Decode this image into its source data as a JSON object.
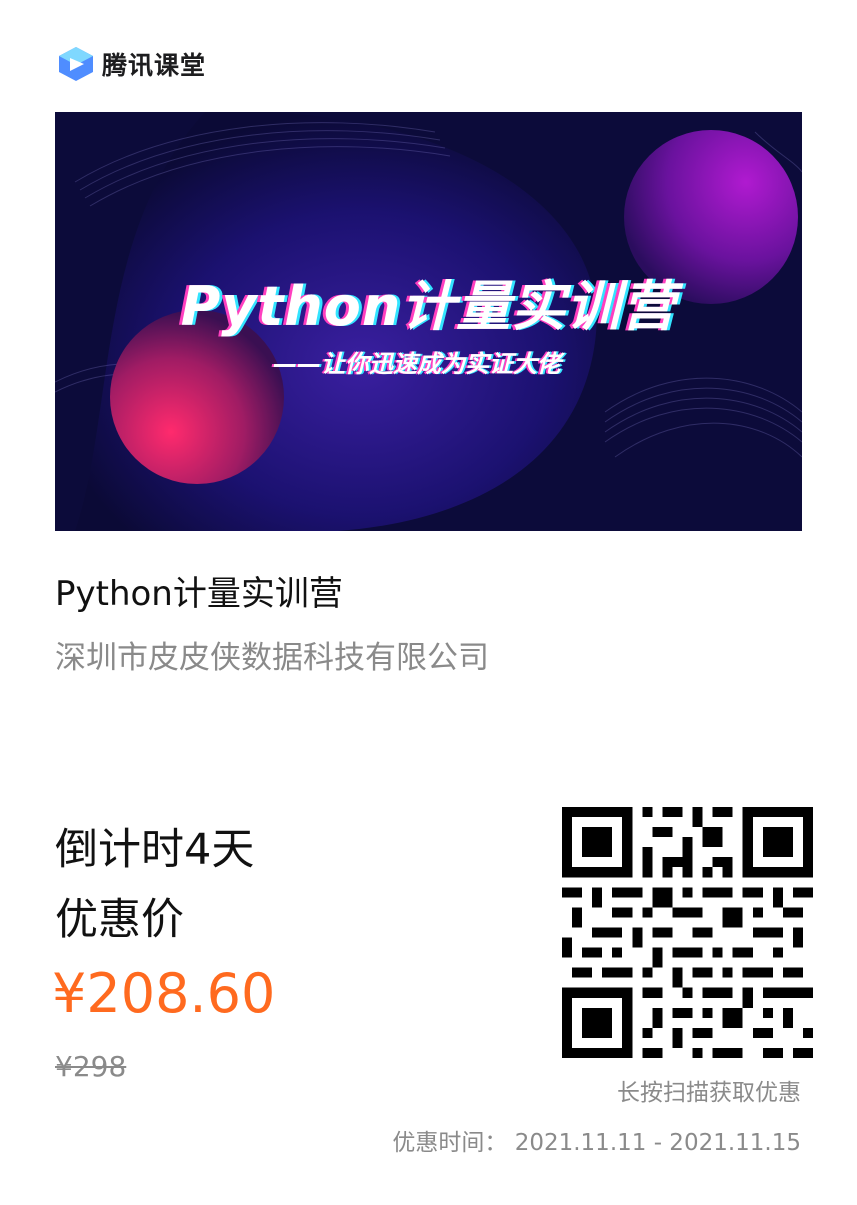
{
  "brand": {
    "name": "腾讯课堂"
  },
  "banner": {
    "title": "Python计量实训营",
    "subtitle": "——让你迅速成为实证大佬"
  },
  "course": {
    "title": "Python计量实训营",
    "organization": "深圳市皮皮侠数据科技有限公司"
  },
  "promo": {
    "countdown": "倒计时4天",
    "label": "优惠价",
    "price": "¥208.60",
    "original_price": "¥298"
  },
  "qr": {
    "hint": "长按扫描获取优惠"
  },
  "period": {
    "text": "优惠时间： 2021.11.11 - 2021.11.15"
  },
  "colors": {
    "price": "#ff6a1f",
    "muted": "#8a8a8a",
    "brand_blue": "#2e6bff"
  },
  "icons": [
    "tencent-classroom-logo-icon",
    "qr-code-icon"
  ]
}
